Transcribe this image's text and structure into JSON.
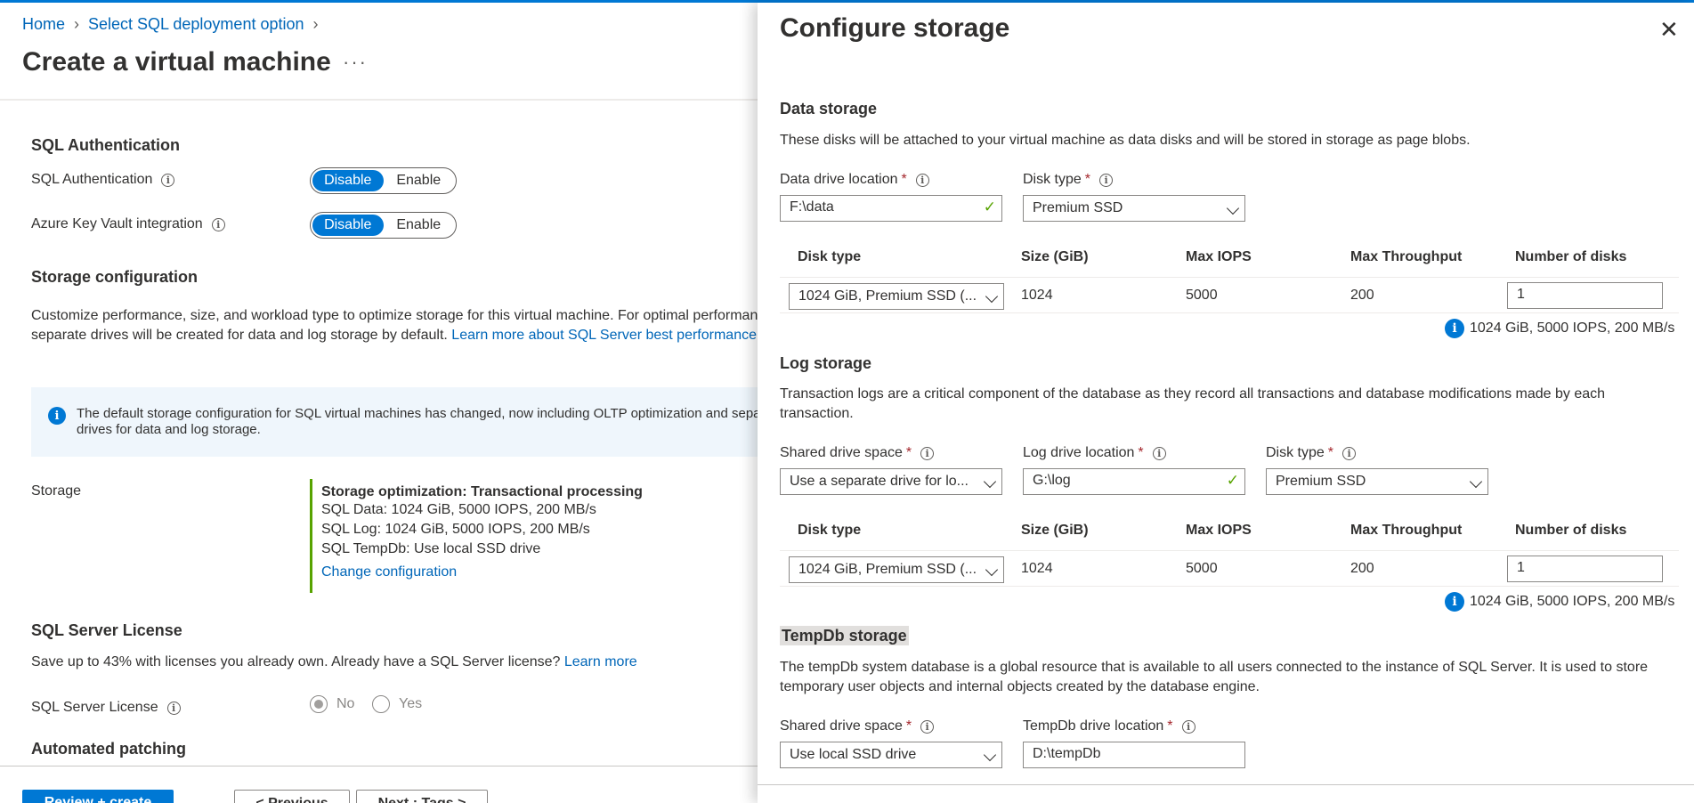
{
  "breadcrumb": {
    "home": "Home",
    "sql_option": "Select SQL deployment option"
  },
  "page": {
    "title": "Create a virtual machine",
    "more": "···"
  },
  "sql_auth": {
    "heading": "SQL Authentication",
    "auth_label": "SQL Authentication",
    "keyvault_label": "Azure Key Vault integration",
    "disable": "Disable",
    "enable": "Enable"
  },
  "storage_config": {
    "heading": "Storage configuration",
    "desc_line1": "Customize performance, size, and workload type to optimize storage for this virtual machine. For optimal performance",
    "desc_line2": "separate drives will be created for data and log storage by default.",
    "desc_link": "Learn more about SQL Server best performance",
    "info_line1": "The default storage configuration for SQL virtual machines has changed, now including OLTP optimization and separate",
    "info_line2": "drives for data and log storage.",
    "storage_label": "Storage",
    "opt_title": "Storage optimization: Transactional processing",
    "data_line": "SQL Data: 1024 GiB, 5000 IOPS, 200 MB/s",
    "log_line": "SQL Log: 1024 GiB, 5000 IOPS, 200 MB/s",
    "tempdb_line": "SQL TempDb: Use local SSD drive",
    "change_link": "Change configuration"
  },
  "license": {
    "heading": "SQL Server License",
    "desc": "Save up to 43% with licenses you already own. Already have a SQL Server license?",
    "learn_more": "Learn more",
    "label": "SQL Server License",
    "no": "No",
    "yes": "Yes",
    "selected": "No"
  },
  "patching": {
    "heading": "Automated patching"
  },
  "footer": {
    "review": "Review + create",
    "previous": "< Previous",
    "next": "Next : Tags >"
  },
  "panel": {
    "title": "Configure storage",
    "data": {
      "heading": "Data storage",
      "desc": "These disks will be attached to your virtual machine as data disks and will be stored in storage as page blobs.",
      "location_label": "Data drive location",
      "location_value": "F:\\data",
      "disktype_label": "Disk type",
      "disktype_value": "Premium SSD",
      "row_disk": "1024 GiB, Premium SSD (...",
      "row_size": "1024",
      "row_iops": "5000",
      "row_throughput": "200",
      "row_count": "1",
      "summary": "1024 GiB, 5000 IOPS, 200 MB/s"
    },
    "grid_headers": {
      "disk_type": "Disk type",
      "size": "Size (GiB)",
      "iops": "Max IOPS",
      "throughput": "Max Throughput",
      "count": "Number of disks"
    },
    "log": {
      "heading": "Log storage",
      "desc_line1": "Transaction logs are a critical component of the database as they record all transactions and database modifications made by each",
      "desc_line2": "transaction.",
      "shared_label": "Shared drive space",
      "shared_value": "Use a separate drive for lo...",
      "location_label": "Log drive location",
      "location_value": "G:\\log",
      "disktype_label": "Disk type",
      "disktype_value": "Premium SSD",
      "row_disk": "1024 GiB, Premium SSD (...",
      "row_size": "1024",
      "row_iops": "5000",
      "row_throughput": "200",
      "row_count": "1",
      "summary": "1024 GiB, 5000 IOPS, 200 MB/s"
    },
    "tempdb": {
      "heading": "TempDb storage",
      "desc_line1": "The tempDb system database is a global resource that is available to all users connected to the instance of SQL Server. It is used to store",
      "desc_line2": "temporary user objects and internal objects created by the database engine.",
      "shared_label": "Shared drive space",
      "shared_value": "Use local SSD drive",
      "location_label": "TempDb drive location",
      "location_value": "D:\\tempDb"
    }
  },
  "colors": {
    "accent": "#0078d4",
    "link": "#0066b8",
    "success": "#57a300",
    "required": "#a4262c",
    "info_bg": "#eff6fc"
  }
}
